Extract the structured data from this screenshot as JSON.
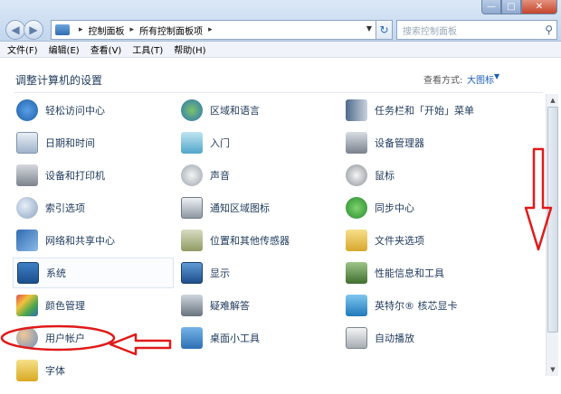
{
  "window": {
    "address": {
      "crumbs": [
        "控制面板",
        "所有控制面板项"
      ]
    },
    "search": {
      "placeholder": "搜索控制面板"
    }
  },
  "menubar": {
    "items": [
      "文件(F)",
      "编辑(E)",
      "查看(V)",
      "工具(T)",
      "帮助(H)"
    ]
  },
  "main": {
    "title": "调整计算机的设置",
    "view_label": "查看方式:",
    "view_value": "大图标"
  },
  "items": {
    "col1": [
      "轻松访问中心",
      "日期和时间",
      "设备和打印机",
      "索引选项",
      "网络和共享中心",
      "系统",
      "颜色管理",
      "用户帐户",
      "字体"
    ],
    "col2": [
      "区域和语言",
      "入门",
      "声音",
      "通知区域图标",
      "位置和其他传感器",
      "显示",
      "疑难解答",
      "桌面小工具"
    ],
    "col3": [
      "任务栏和「开始」菜单",
      "设备管理器",
      "鼠标",
      "同步中心",
      "文件夹选项",
      "性能信息和工具",
      "英特尔® 核芯显卡",
      "自动播放"
    ]
  },
  "colors": {
    "annotation": "#e11a1a",
    "link": "#1e395b",
    "accent": "#1e5fb4"
  }
}
